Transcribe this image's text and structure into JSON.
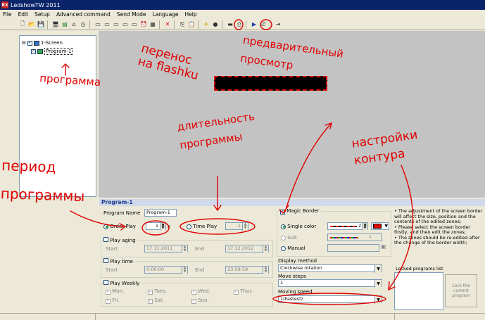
{
  "window": {
    "title": "LedshowTW 2011",
    "icon_text": "BX"
  },
  "menu": [
    "File",
    "Edit",
    "Setup",
    "Advanced command",
    "Send Mode",
    "Language",
    "Help"
  ],
  "toolbar_icons": [
    "new-file-icon",
    "open-file-icon",
    "save-icon",
    "sep",
    "add-screen-icon",
    "add-program-icon",
    "home-icon",
    "clock-icon",
    "sep",
    "area-icon",
    "area-icon",
    "area-icon",
    "area-icon",
    "area-icon",
    "alarm-icon",
    "chart-icon",
    "sep",
    "delete-icon",
    "sep",
    "copy-icon",
    "paste-icon",
    "sep",
    "brightness-icon",
    "record-icon",
    "sep",
    "usb-icon",
    "usb-save-icon",
    "sep",
    "play-icon",
    "preview-icon",
    "sep",
    "exit-icon"
  ],
  "tree": {
    "screen": "1-Screen",
    "program": "Program-1"
  },
  "panel": {
    "title": "Program-1",
    "program_name_label": "Program Name",
    "program_name_value": "Program-1",
    "order_play_label": "Order Play",
    "order_play_value": "1",
    "time_play_label": "Time Play",
    "time_play_value": "1",
    "play_aging_label": "Play aging",
    "start_label": "Start",
    "end_label": "End",
    "start_date": "17.11.2011",
    "end_date": "17.12.2012",
    "play_time_label": "Play time",
    "start_time": "0:00:00",
    "end_time": "23:59:59",
    "play_weekly_label": "Play Weekly",
    "days": [
      "Mon.",
      "Tues.",
      "Wed.",
      "Thur.",
      "Fri.",
      "Sat.",
      "Sun."
    ]
  },
  "border": {
    "magic_border_label": "Magic Border",
    "single_color_label": "Single color",
    "single_color_value": "2",
    "suit_label": "Suit",
    "suit_value": "1",
    "manual_label": "Manual",
    "display_method_label": "Display method",
    "display_method_value": "Clockwise rotation",
    "move_steps_label": "Move steps",
    "move_steps_value": "1",
    "moving_speed_label": "Moving speed",
    "moving_speed_value": "1(Fastest)"
  },
  "notes": {
    "text": "• The adjustment of the screen border will affect the size, position and the contents of the edited zones;\n• Please select the screen border firstly, and then edit the zones;\n• The zones should be re-edited after the change of the border width;",
    "locked_list_label": "Locked programs list",
    "lock_button": "Lock the current program"
  },
  "annotations": {
    "flash": "перенос на flashku",
    "preview": "предварительный просмотр",
    "program": "программа",
    "duration": "длительность программы",
    "period": "период программы",
    "border_settings": "настройки контура"
  },
  "colors": {
    "annotation": "#e00000",
    "titlebar": "#0a246a",
    "preview_bg": "#c3c3c3",
    "led_area": "#000000",
    "border_dash": "#dd0000"
  }
}
